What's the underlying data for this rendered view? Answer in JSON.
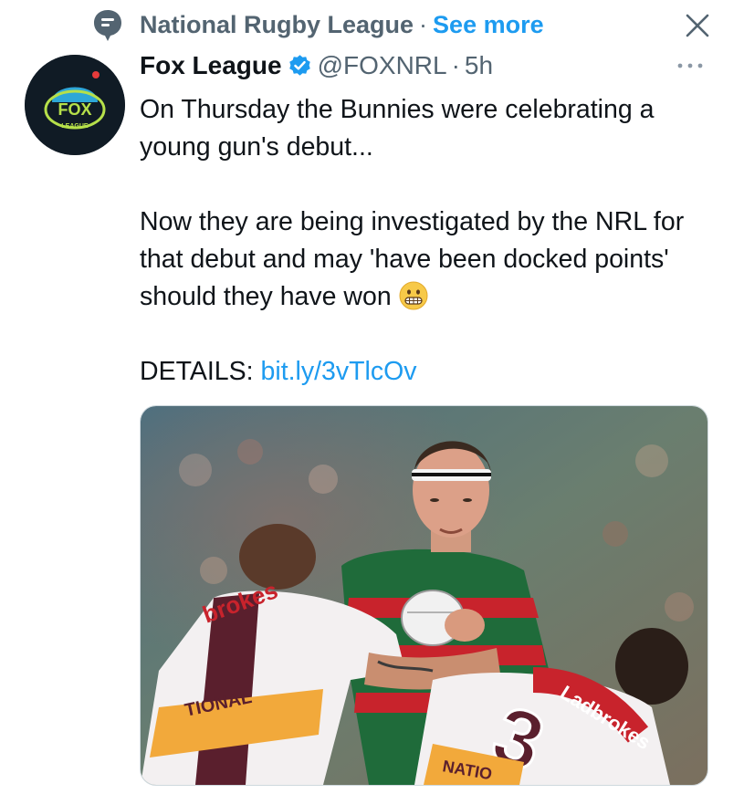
{
  "topic": {
    "icon": "topic-pin-icon",
    "label": "National Rugby League",
    "separator": "·",
    "see_more": "See more"
  },
  "close": {
    "icon": "close-icon",
    "glyph": "×"
  },
  "author": {
    "avatar_text": "FOX",
    "avatar_subtext": "LEAGUE",
    "name": "Fox League",
    "verified_icon": "verified-badge-icon",
    "handle": "@FOXNRL",
    "separator": "·",
    "time": "5h",
    "more_icon": "more-options-icon"
  },
  "tweet": {
    "line1": "On Thursday the Bunnies were celebrating a young gun's debut...",
    "line2": "Now they are being investigated by the NRL for that debut and may 'have been docked points' should they have won",
    "emoji": "grimacing-face-emoji",
    "details_label": "DETAILS:",
    "details_link": "bit.ly/3vTlcOv"
  },
  "media": {
    "jersey_back_number": "3",
    "sponsor_text": "Ladbrokes",
    "sponsor_text_left": "brokes",
    "banner_text_left": "TIONAL\nVICE",
    "banner_text_right": "NATIO\nSTO",
    "colors": {
      "rabbitoh_green": "#1f6b3a",
      "rabbitoh_red": "#c8232c",
      "bronco_maroon": "#5a1f2d",
      "bronco_gold": "#f2a93b"
    }
  },
  "colors": {
    "accent": "#1d9bf0",
    "secondary_text": "#536471",
    "primary_text": "#0f1419"
  }
}
